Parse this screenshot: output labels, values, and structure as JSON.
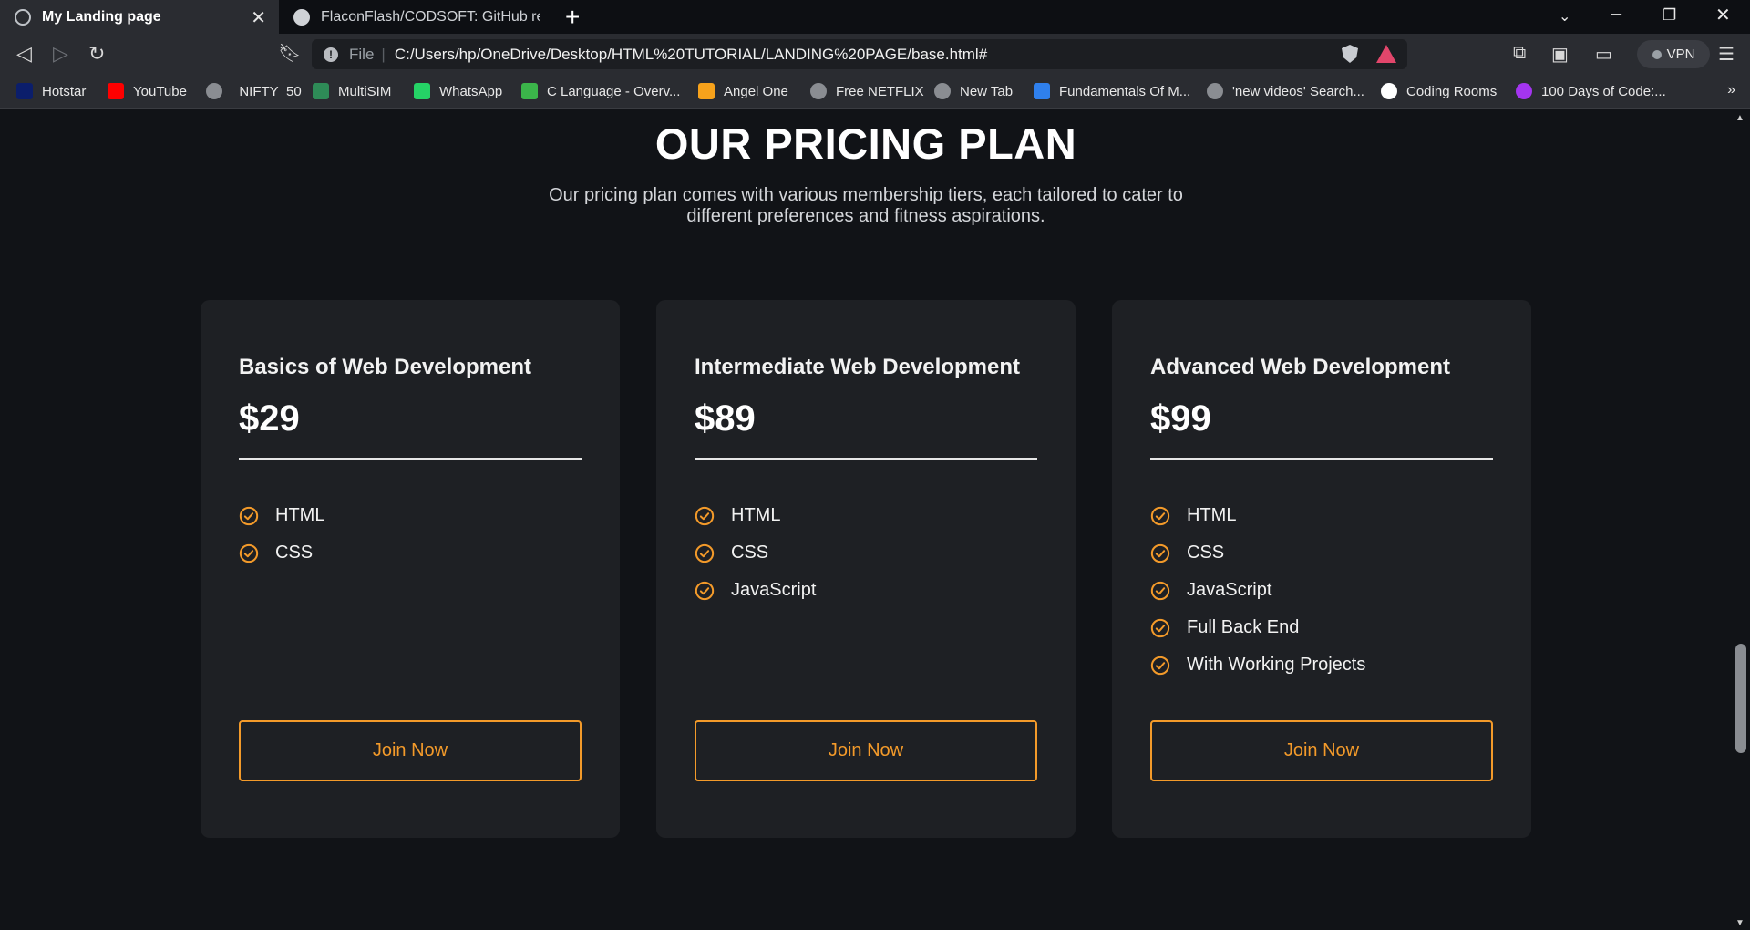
{
  "browser": {
    "tabs": [
      {
        "title": "My Landing page",
        "active": true
      },
      {
        "title": "FlaconFlash/CODSOFT: GitHub reposit",
        "active": false
      }
    ],
    "url_scheme": "File",
    "url": "C:/Users/hp/OneDrive/Desktop/HTML%20TUTORIAL/LANDING%20PAGE/base.html#",
    "vpn_label": "VPN",
    "bookmarks": [
      {
        "label": "Hotstar",
        "icon": "hotstar-icon",
        "color": "#0b1e6b"
      },
      {
        "label": "YouTube",
        "icon": "youtube-icon",
        "color": "#ff0000"
      },
      {
        "label": "_NIFTY_50",
        "icon": "globe-icon",
        "color": "#8a8d92"
      },
      {
        "label": "MultiSIM",
        "icon": "multisim-icon",
        "color": "#2e8b57"
      },
      {
        "label": "WhatsApp",
        "icon": "whatsapp-icon",
        "color": "#25d366"
      },
      {
        "label": "C Language - Overv...",
        "icon": "c-language-icon",
        "color": "#3bb54a"
      },
      {
        "label": "Angel One",
        "icon": "angel-one-icon",
        "color": "#f7a21b"
      },
      {
        "label": "Free NETFLIX",
        "icon": "globe-icon",
        "color": "#8a8d92"
      },
      {
        "label": "New Tab",
        "icon": "globe-icon",
        "color": "#8a8d92"
      },
      {
        "label": "Fundamentals Of M...",
        "icon": "scaler-icon",
        "color": "#2f80ed"
      },
      {
        "label": "'new videos' Search...",
        "icon": "globe-icon",
        "color": "#8a8d92"
      },
      {
        "label": "Coding Rooms",
        "icon": "coding-rooms-icon",
        "color": "#ffffff"
      },
      {
        "label": "100 Days of Code:...",
        "icon": "udemy-icon",
        "color": "#a435f0"
      }
    ]
  },
  "page": {
    "heading": "OUR PRICING PLAN",
    "subtitle": "Our pricing plan comes with various membership tiers, each tailored to cater to different preferences and fitness aspirations.",
    "accent_color": "#f39a2a",
    "plans": [
      {
        "title": "Basics of Web Development",
        "price": "$29",
        "features": [
          "HTML",
          "CSS"
        ],
        "button": "Join Now"
      },
      {
        "title": "Intermediate Web Development",
        "price": "$89",
        "features": [
          "HTML",
          "CSS",
          "JavaScript"
        ],
        "button": "Join Now"
      },
      {
        "title": "Advanced Web Development",
        "price": "$99",
        "features": [
          "HTML",
          "CSS",
          "JavaScript",
          "Full Back End",
          "With Working Projects"
        ],
        "button": "Join Now"
      }
    ]
  }
}
